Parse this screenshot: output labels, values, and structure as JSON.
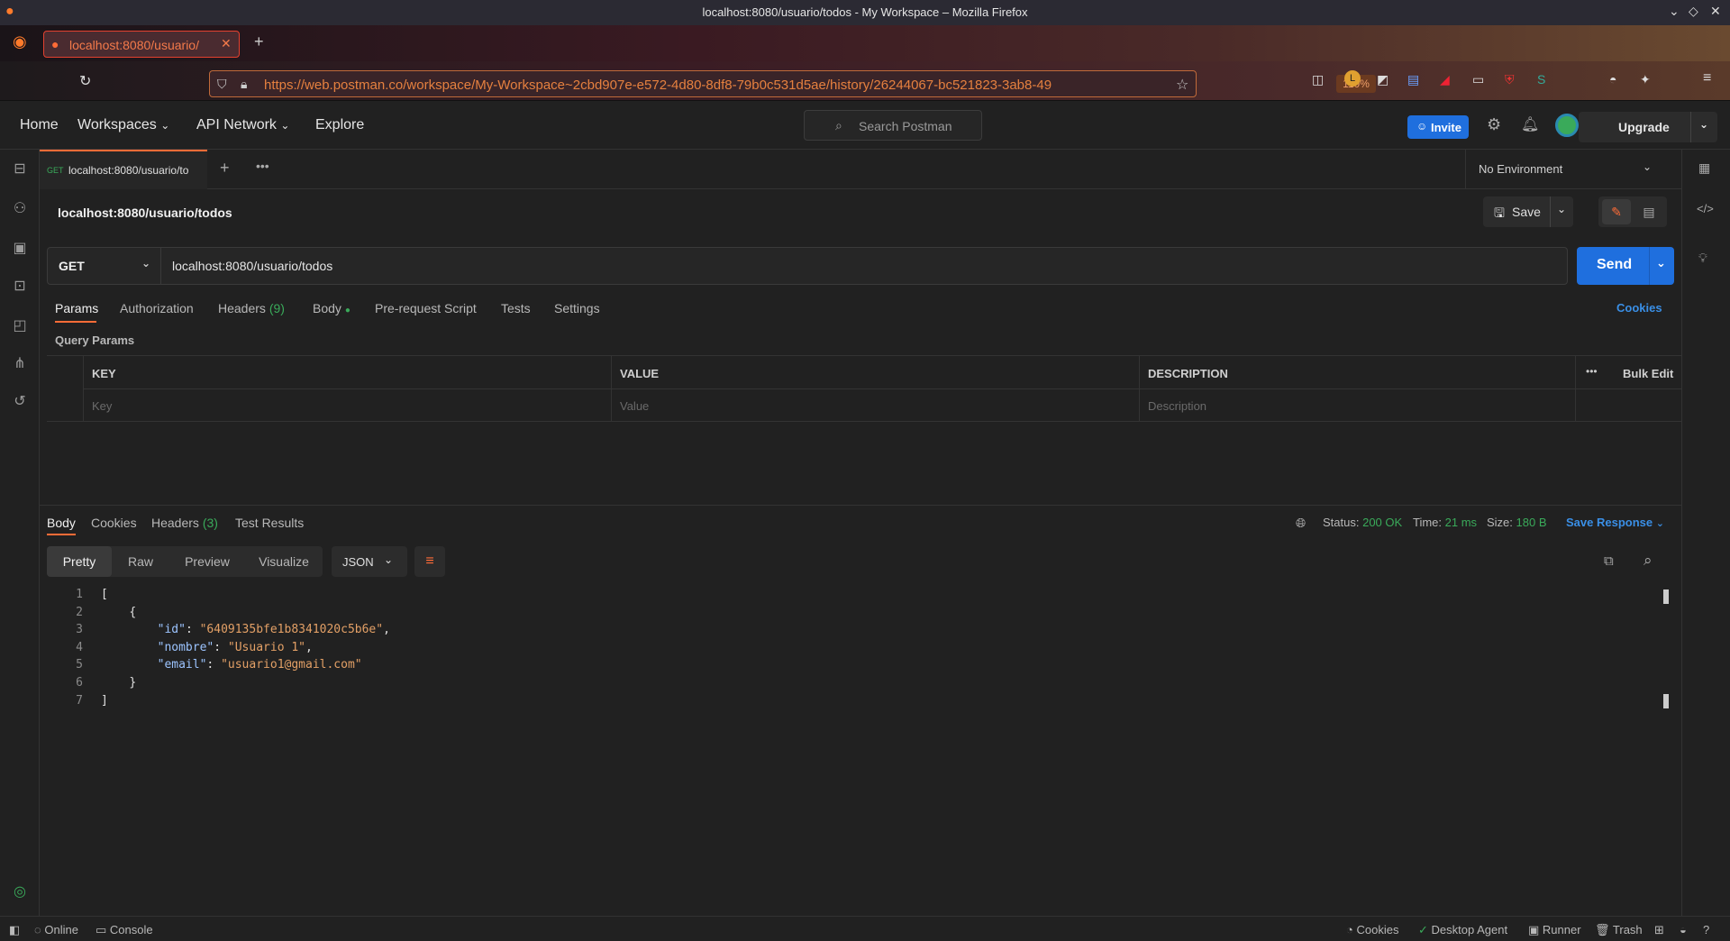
{
  "window": {
    "title": "localhost:8080/usuario/todos - My Workspace – Mozilla Firefox"
  },
  "browser": {
    "tab_label": "localhost:8080/usuario/",
    "url": "https://web.postman.co/workspace/My-Workspace~2cbd907e-e572-4d80-8df8-79b0c531d5ae/history/26244067-bc521823-3ab8-49",
    "zoom": "110%"
  },
  "header": {
    "home": "Home",
    "workspaces": "Workspaces",
    "api_network": "API Network",
    "explore": "Explore",
    "search_placeholder": "Search Postman",
    "invite": "Invite",
    "upgrade": "Upgrade"
  },
  "tabs": {
    "method_badge": "GET",
    "tab_label": "localhost:8080/usuario/to",
    "environment": "No Environment"
  },
  "request": {
    "title": "localhost:8080/usuario/todos",
    "save": "Save",
    "method": "GET",
    "url": "localhost:8080/usuario/todos",
    "send": "Send",
    "subtabs": {
      "params": "Params",
      "authorization": "Authorization",
      "headers": "Headers",
      "headers_count": "(9)",
      "body": "Body",
      "pre_request": "Pre-request Script",
      "tests": "Tests",
      "settings": "Settings",
      "cookies": "Cookies"
    },
    "query_params_label": "Query Params",
    "table": {
      "key": "KEY",
      "value": "VALUE",
      "description": "DESCRIPTION",
      "bulk_edit": "Bulk Edit",
      "key_ph": "Key",
      "value_ph": "Value",
      "description_ph": "Description"
    }
  },
  "response": {
    "tabs": {
      "body": "Body",
      "cookies": "Cookies",
      "headers": "Headers",
      "headers_count": "(3)",
      "test_results": "Test Results"
    },
    "status_label": "Status:",
    "status_value": "200 OK",
    "time_label": "Time:",
    "time_value": "21 ms",
    "size_label": "Size:",
    "size_value": "180 B",
    "save_response": "Save Response",
    "views": {
      "pretty": "Pretty",
      "raw": "Raw",
      "preview": "Preview",
      "visualize": "Visualize"
    },
    "format": "JSON",
    "lines": [
      {
        "n": "1",
        "indent": "",
        "k": "",
        "sep": "",
        "v": "",
        "tail": "["
      },
      {
        "n": "2",
        "indent": "    ",
        "k": "",
        "sep": "",
        "v": "",
        "tail": "{"
      },
      {
        "n": "3",
        "indent": "        ",
        "k": "\"id\"",
        "sep": ": ",
        "v": "\"6409135bfe1b8341020c5b6e\"",
        "tail": ","
      },
      {
        "n": "4",
        "indent": "        ",
        "k": "\"nombre\"",
        "sep": ": ",
        "v": "\"Usuario 1\"",
        "tail": ","
      },
      {
        "n": "5",
        "indent": "        ",
        "k": "\"email\"",
        "sep": ": ",
        "v": "\"usuario1@gmail.com\"",
        "tail": ""
      },
      {
        "n": "6",
        "indent": "    ",
        "k": "",
        "sep": "",
        "v": "",
        "tail": "}"
      },
      {
        "n": "7",
        "indent": "",
        "k": "",
        "sep": "",
        "v": "",
        "tail": "]"
      }
    ]
  },
  "statusbar": {
    "online": "Online",
    "console": "Console",
    "cookies": "Cookies",
    "desktop_agent": "Desktop Agent",
    "runner": "Runner",
    "trash": "Trash"
  },
  "colors": {
    "accent": "#ff6c37",
    "primary": "#1f6fde",
    "success": "#3aaa5a"
  }
}
